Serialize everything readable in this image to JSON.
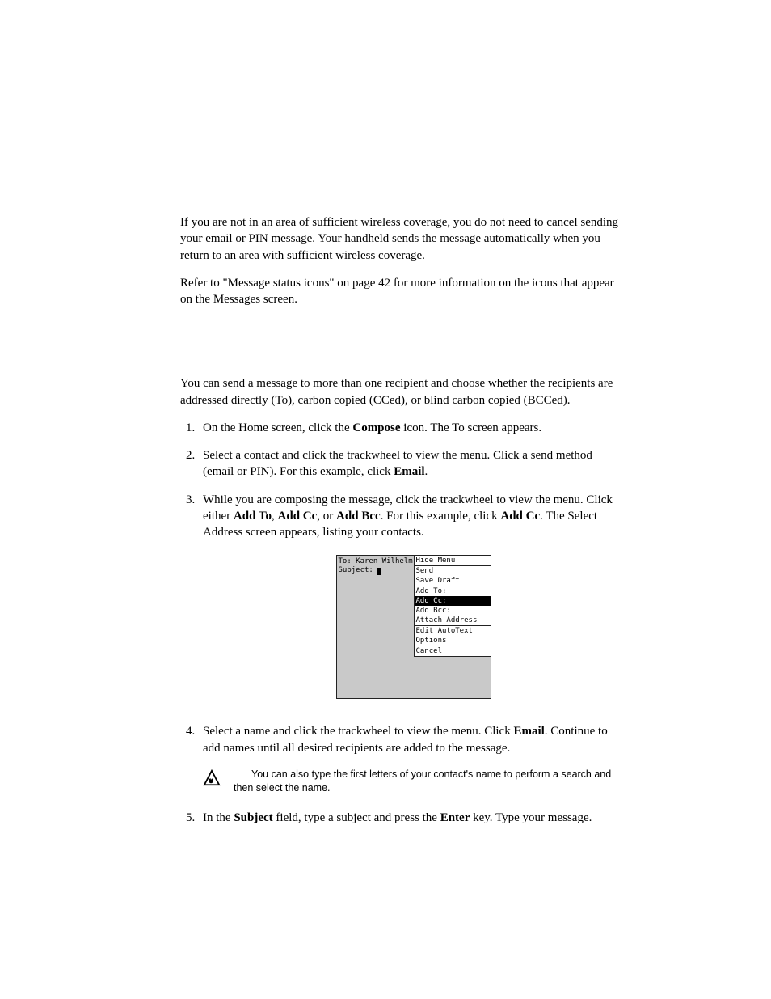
{
  "para1": "If you are not in an area of sufficient wireless coverage, you do not need to cancel sending your email or PIN message. Your handheld sends the message automatically when you return to an area with sufficient wireless coverage.",
  "para2": "Refer to \"Message status icons\" on page 42 for more information on the icons that appear on the Messages screen.",
  "para3": "You can send a message to more than one recipient and choose whether the recipients are addressed directly (To), carbon copied (CCed), or blind carbon copied (BCCed).",
  "steps": {
    "s1_a": "On the Home screen, click the ",
    "s1_bold": "Compose",
    "s1_b": " icon. The To screen appears.",
    "s2_a": "Select a contact and click the trackwheel to view the menu. Click a send method (email or PIN). For this example, click ",
    "s2_bold": "Email",
    "s2_b": ".",
    "s3_a": "While you are composing the message, click the trackwheel to view the menu. Click either ",
    "s3_b1": "Add To",
    "s3_c1": ", ",
    "s3_b2": "Add Cc",
    "s3_c2": ", or ",
    "s3_b3": "Add Bcc",
    "s3_c3": ". For this example, click ",
    "s3_b4": "Add Cc",
    "s3_c4": ". The Select Address screen appears, listing your contacts.",
    "s4_a": "Select a name and click the trackwheel to view the menu. Click ",
    "s4_bold": "Email",
    "s4_b": ". Continue to add names until all desired recipients are added to the message.",
    "s5_a": "In the ",
    "s5_b1": "Subject",
    "s5_c1": " field, type a subject and press the ",
    "s5_b2": "Enter",
    "s5_c2": " key. Type your message."
  },
  "tip": "You can also type the first letters of your contact's name to perform a search and then select the name.",
  "screenshot": {
    "to_line": "To: Karen Wilhelm",
    "subject_label": "Subject: ",
    "menu": {
      "g1": [
        "Hide Menu"
      ],
      "g2": [
        "Send",
        "Save Draft"
      ],
      "g3": [
        "Add To:",
        "Add Cc:",
        "Add Bcc:",
        "Attach Address"
      ],
      "g4": [
        "Edit AutoText",
        "Options"
      ],
      "g5": [
        "Cancel"
      ]
    },
    "selected": "Add Cc:"
  }
}
